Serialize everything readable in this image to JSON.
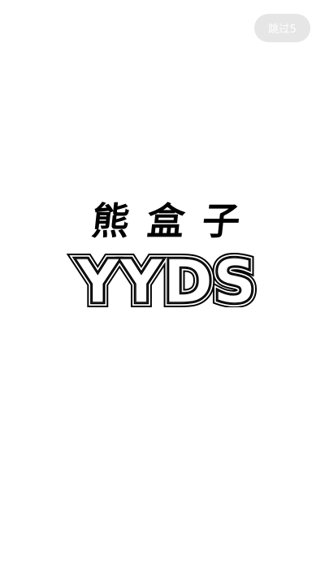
{
  "skip": {
    "label": "跳过5"
  },
  "logo": {
    "title_chars": [
      "熊",
      "盒",
      "子"
    ],
    "wordmark": "YYDS"
  },
  "colors": {
    "background": "#ffffff",
    "skip_button_bg": "#e6e6e6",
    "skip_button_text": "#ffffff",
    "logo": "#000000"
  }
}
